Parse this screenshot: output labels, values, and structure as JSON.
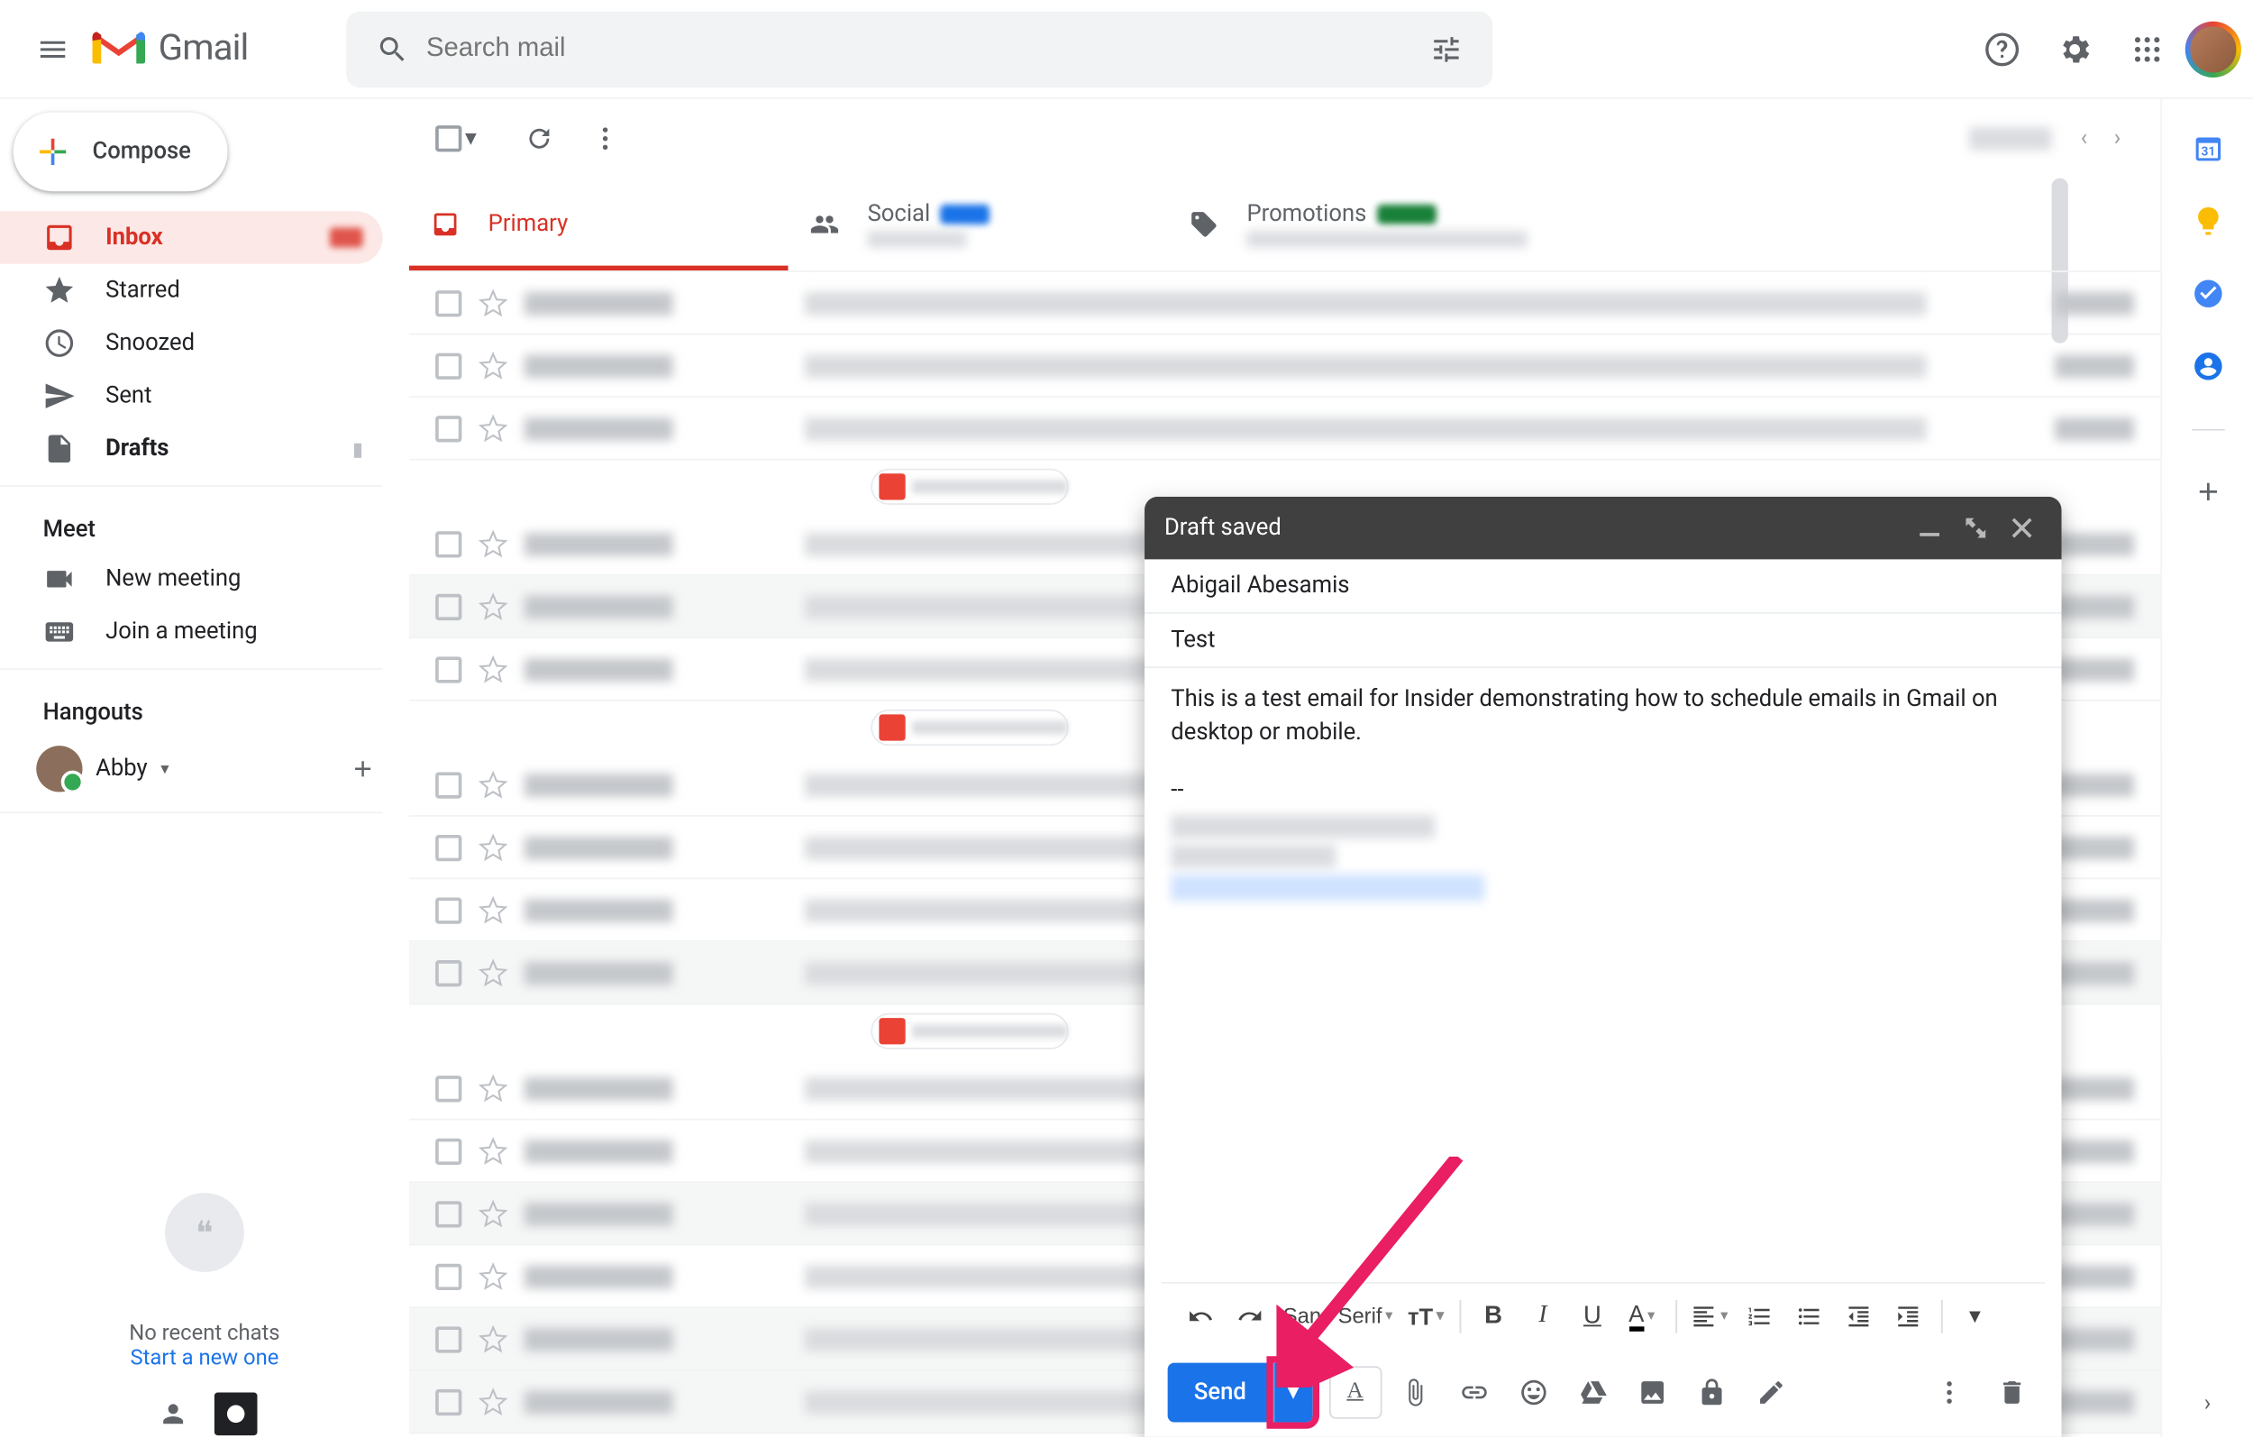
{
  "header": {
    "product_name": "Gmail",
    "search_placeholder": "Search mail"
  },
  "compose_button": "Compose",
  "sidebar": {
    "folders": [
      {
        "label": "Inbox",
        "active": true,
        "bold": true,
        "icon": "inbox",
        "badge": true
      },
      {
        "label": "Starred",
        "icon": "star"
      },
      {
        "label": "Snoozed",
        "icon": "clock"
      },
      {
        "label": "Sent",
        "icon": "send"
      },
      {
        "label": "Drafts",
        "icon": "file",
        "bold": true
      }
    ],
    "meet_label": "Meet",
    "meet_items": [
      {
        "label": "New meeting",
        "icon": "video"
      },
      {
        "label": "Join a meeting",
        "icon": "keyboard"
      }
    ],
    "hangouts_label": "Hangouts",
    "hangouts_user": "Abby",
    "no_chats": "No recent chats",
    "start_chat": "Start a new one"
  },
  "tabs": [
    {
      "label": "Primary",
      "active": true
    },
    {
      "label": "Social",
      "badge_color": "blue"
    },
    {
      "label": "Promotions",
      "badge_color": "green"
    }
  ],
  "compose_window": {
    "title": "Draft saved",
    "recipient": "Abigail Abesamis",
    "subject": "Test",
    "body": "This is a test email for Insider demonstrating how to schedule emails in Gmail on desktop or mobile.",
    "signature_marker": "--",
    "font_label": "Sans Serif",
    "send_label": "Send"
  },
  "email_rows": 16
}
